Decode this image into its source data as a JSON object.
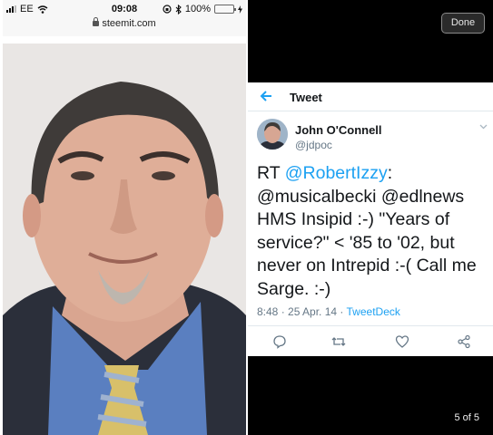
{
  "left_screen": {
    "status_bar": {
      "carrier": "EE",
      "time": "09:08",
      "battery_percent": "100%",
      "battery_level": 1.0
    },
    "url_bar": {
      "url": "steemit.com"
    },
    "photo": {
      "icon": "portrait-photo"
    }
  },
  "viewer": {
    "done_label": "Done",
    "counter": "5 of 5"
  },
  "tweet": {
    "header_title": "Tweet",
    "author_name": "John O'Connell",
    "author_handle": "@jdpoc",
    "text_prefix": "RT ",
    "mention1": "@RobertIzzy",
    "text_line2": ": @musicalbecki @edlnews HMS Insipid :-) \"Years of service?\" < '85 to '02, but never on Intrepid :-( Call me Sarge. :-)",
    "timestamp": "8:48 · 25 Apr. 14 · ",
    "source": "TweetDeck",
    "colors": {
      "link": "#1da1f2",
      "text": "#14171a",
      "muted": "#657786"
    }
  }
}
